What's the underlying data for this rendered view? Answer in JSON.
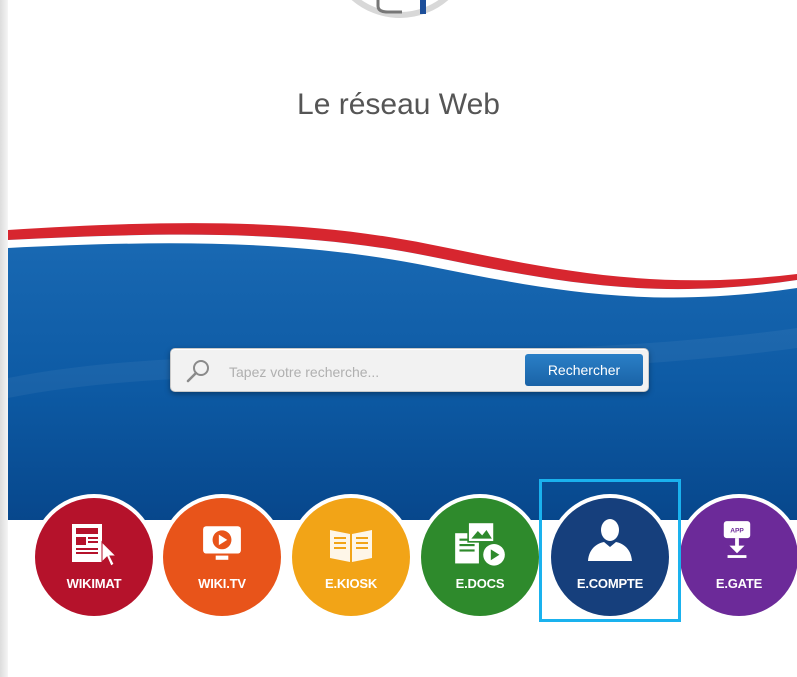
{
  "header": {
    "title": "Le réseau Web"
  },
  "search": {
    "placeholder": "Tapez votre recherche...",
    "button_label": "Rechercher"
  },
  "apps": [
    {
      "label": "WIKIMAT",
      "icon": "newspaper-cursor-icon",
      "color": "#b5122b"
    },
    {
      "label": "WIKI.TV",
      "icon": "play-screen-icon",
      "color": "#e8541a"
    },
    {
      "label": "E.KIOSK",
      "icon": "open-book-icon",
      "color": "#f2a417"
    },
    {
      "label": "E.DOCS",
      "icon": "documents-media-icon",
      "color": "#2e8a2c"
    },
    {
      "label": "E.COMPTE",
      "icon": "user-silhouette-icon",
      "color": "#163f7c"
    },
    {
      "label": "E.GATE",
      "icon": "app-download-icon",
      "color": "#6c2a99"
    }
  ],
  "colors": {
    "banner_blue": "#0e5aa5",
    "banner_red": "#d7262f",
    "highlight": "#1ab2ee"
  }
}
